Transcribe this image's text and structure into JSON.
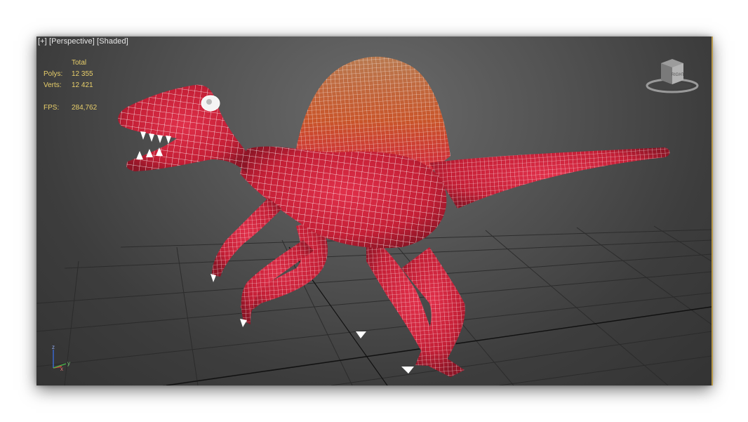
{
  "viewport": {
    "label_plus": "[+]",
    "label_view": "[Perspective]",
    "label_mode": "[Shaded]"
  },
  "stats": {
    "header": "Total",
    "polys_label": "Polys:",
    "polys_value": "12 355",
    "verts_label": "Verts:",
    "verts_value": "12 421",
    "fps_label": "FPS:",
    "fps_value": "284,762"
  },
  "viewcube": {
    "face_label": "RIGHT"
  },
  "axis_gizmo": {
    "z": "z",
    "x": "x",
    "y": "y"
  },
  "colors": {
    "model_red": "#d2253d",
    "sail_orange": "#c85a2a",
    "wire": "#ffffff",
    "stats_text": "#e9cf6a"
  },
  "icons": {
    "viewcube": "viewcube-icon",
    "axis": "axis-gizmo-icon"
  }
}
